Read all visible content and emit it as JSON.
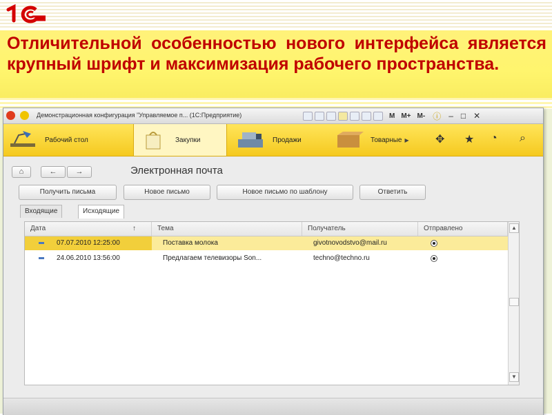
{
  "slide": {
    "headline": "Отличительной особенностью нового интерфейса является крупный шрифт и максимизация рабочего пространства."
  },
  "window": {
    "title": "Демонстрационная конфигурация \"Управляемое п... (1С:Предприятие)",
    "toolbar_m": "M",
    "toolbar_mplus": "M+",
    "toolbar_mminus": "M-"
  },
  "sections": [
    {
      "label": "Рабочий стол",
      "icon": "desk-lamp-icon"
    },
    {
      "label": "Закупки",
      "icon": "shopping-bag-icon"
    },
    {
      "label": "Продажи",
      "icon": "cash-register-icon"
    },
    {
      "label": "Товарные",
      "icon": "box-icon"
    }
  ],
  "form": {
    "title": "Электронная почта",
    "buttons": {
      "get": "Получить письма",
      "new": "Новое письмо",
      "template": "Новое письмо по шаблону",
      "reply": "Ответить"
    },
    "tabs": {
      "inbox": "Входящие",
      "outbox": "Исходящие"
    },
    "columns": {
      "date": "Дата",
      "subject": "Тема",
      "recipient": "Получатель",
      "sent": "Отправлено"
    },
    "sort_arrow": "↑",
    "rows": [
      {
        "date": "07.07.2010 12:25:00",
        "subject": "Поставка молока",
        "recipient": "givotnovodstvo@mail.ru",
        "sent": true
      },
      {
        "date": "24.06.2010 13:56:00",
        "subject": "Предлагаем телевизоры Son...",
        "recipient": "techno@techno.ru",
        "sent": true
      }
    ]
  },
  "colors": {
    "accent": "#f5c91f",
    "headline": "#c00000",
    "selected_row": "#fbeb9a"
  }
}
